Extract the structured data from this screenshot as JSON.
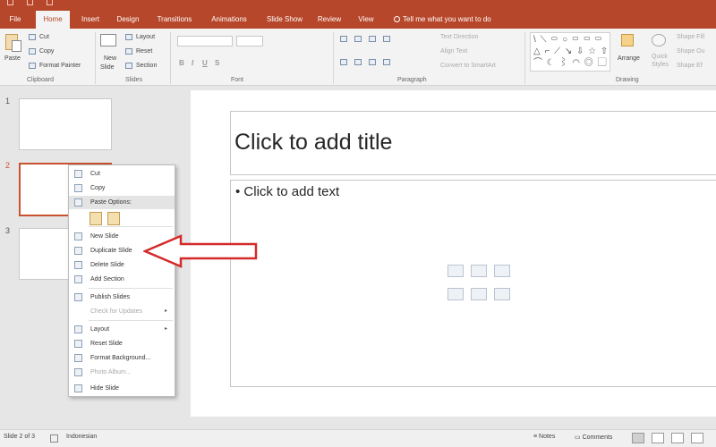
{
  "tabs": [
    "File",
    "Home",
    "Insert",
    "Design",
    "Transitions",
    "Animations",
    "Slide Show",
    "Review",
    "View"
  ],
  "tell_me": "Tell me what you want to do",
  "ribbon": {
    "paste": "Paste",
    "cut": "Cut",
    "copy": "Copy",
    "format_painter": "Format Painter",
    "clipboard_label": "Clipboard",
    "new_slide": "New",
    "new_slide_2": "Slide",
    "layout": "Layout",
    "reset": "Reset",
    "section": "Section",
    "slides_label": "Slides",
    "font_label": "Font",
    "text_direction": "Text Direction",
    "align_text": "Align Text",
    "convert_smartart": "Convert to SmartArt",
    "paragraph_label": "Paragraph",
    "shapes_glyphs": "\\ ⟍ ▭ ○ ▭ ▭ ▭\n△ ⌐ ⟋ ↘ ⇩ ☆ ⇧\n⌒ ☾ ⌇ ◠ ◎ ▢ ☐",
    "arrange": "Arrange",
    "quick_styles": "Quick",
    "quick_styles_2": "Styles",
    "shape_fill": "Shape Fill",
    "shape_outline": "Shape Ou",
    "shape_effects": "Shape Ef",
    "drawing_label": "Drawing"
  },
  "thumbnails": [
    "1",
    "2",
    "3"
  ],
  "slide": {
    "title_placeholder": "Click to add title",
    "body_placeholder": "Click to add text"
  },
  "context_menu": {
    "cut": "Cut",
    "copy": "Copy",
    "paste_options": "Paste Options:",
    "new_slide": "New Slide",
    "duplicate_slide": "Duplicate Slide",
    "delete_slide": "Delete Slide",
    "add_section": "Add Section",
    "publish_slides": "Publish Slides",
    "check_updates": "Check for Updates",
    "layout": "Layout",
    "reset_slide": "Reset Slide",
    "format_background": "Format Background...",
    "photo_album": "Photo Album...",
    "hide_slide": "Hide Slide"
  },
  "status": {
    "slide_info": "Slide 2 of 3",
    "language": "Indonesian",
    "notes": "Notes",
    "comments": "Comments"
  },
  "colors": {
    "accent": "#b7472a",
    "arrow": "#d42a2a"
  }
}
